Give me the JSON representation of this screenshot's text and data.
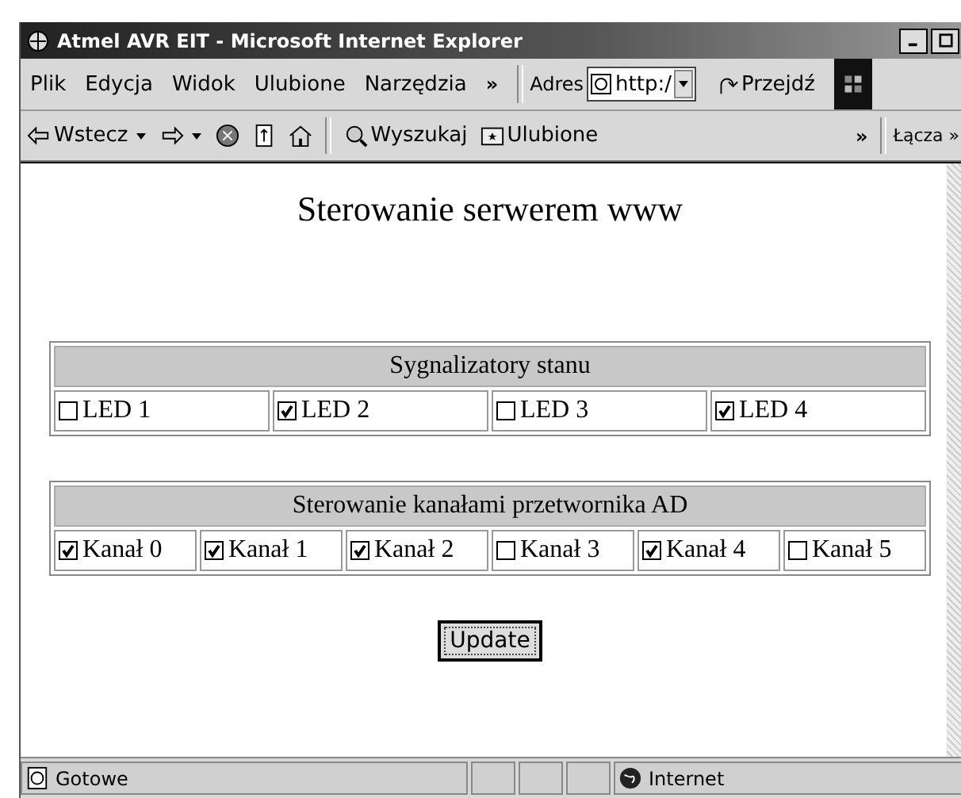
{
  "window": {
    "title": "Atmel AVR EIT - Microsoft Internet Explorer"
  },
  "menu": [
    "Plik",
    "Edycja",
    "Widok",
    "Ulubione",
    "Narzędzia"
  ],
  "menu_more": "»",
  "address": {
    "label": "Adres",
    "value": "http:/",
    "go": "Przejdź"
  },
  "toolbar": {
    "back": "Wstecz",
    "search": "Wyszukaj",
    "favorites": "Ulubione",
    "more": "»",
    "links": "Łącza",
    "links_more": "»"
  },
  "page": {
    "heading": "Sterowanie serwerem www",
    "leds": {
      "title": "Sygnalizatory stanu",
      "items": [
        {
          "label": "LED 1",
          "checked": false
        },
        {
          "label": "LED 2",
          "checked": true
        },
        {
          "label": "LED 3",
          "checked": false
        },
        {
          "label": "LED 4",
          "checked": true
        }
      ]
    },
    "channels": {
      "title": "Sterowanie kanałami przetwornika AD",
      "items": [
        {
          "label": "Kanał 0",
          "checked": true
        },
        {
          "label": "Kanał 1",
          "checked": true
        },
        {
          "label": "Kanał 2",
          "checked": true
        },
        {
          "label": "Kanał 3",
          "checked": false
        },
        {
          "label": "Kanał 4",
          "checked": true
        },
        {
          "label": "Kanał 5",
          "checked": false
        }
      ]
    },
    "button": "Update"
  },
  "status_bar": {
    "text": "Gotowe",
    "zone": "Internet"
  }
}
